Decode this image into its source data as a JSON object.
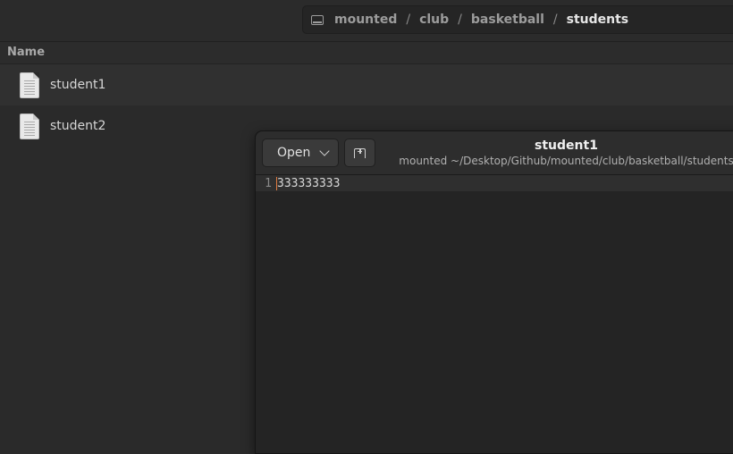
{
  "breadcrumb": {
    "items": [
      "mounted",
      "club",
      "basketball",
      "students"
    ],
    "separator": "/",
    "drive_icon": "drive-icon"
  },
  "file_list": {
    "column_name": "Name",
    "files": [
      {
        "name": "student1",
        "icon": "text-file-icon"
      },
      {
        "name": "student2",
        "icon": "text-file-icon"
      }
    ]
  },
  "editor": {
    "open_label": "Open",
    "title": "student1",
    "subtitle": "mounted ~/Desktop/Github/mounted/club/basketball/students",
    "lines": [
      {
        "number": "1",
        "text": "333333333"
      }
    ]
  },
  "colors": {
    "cursor": "#e07a40",
    "background": "#2a2a2a"
  }
}
